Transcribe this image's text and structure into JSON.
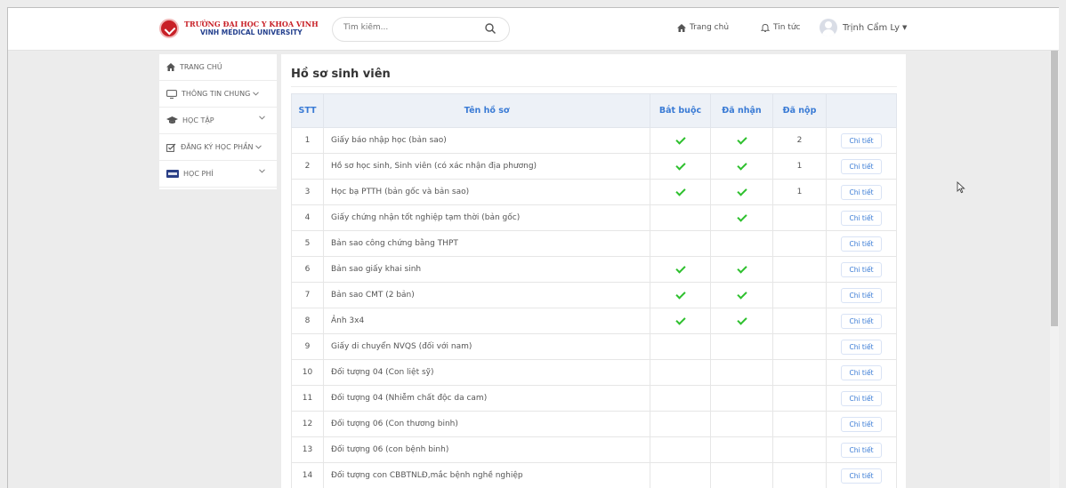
{
  "header": {
    "logo_line1": "TRƯỜNG ĐẠI HỌC Y KHOA VINH",
    "logo_line2": "VINH MEDICAL UNIVERSITY",
    "search_placeholder": "Tìm kiếm...",
    "nav_home": "Trang chủ",
    "nav_news": "Tin tức",
    "user_name": "Trịnh Cẩm Ly"
  },
  "sidebar": {
    "items": [
      {
        "label": "TRANG CHỦ",
        "icon": "home-icon"
      },
      {
        "label": "THÔNG TIN CHUNG",
        "icon": "monitor-icon"
      },
      {
        "label": "HỌC TẬP",
        "icon": "graduation-cap-icon"
      },
      {
        "label": "ĐĂNG KÝ HỌC PHẦN",
        "icon": "edit-icon"
      },
      {
        "label": "HỌC PHÍ",
        "icon": "visa-card-icon"
      }
    ]
  },
  "main": {
    "title": "Hồ sơ sinh viên",
    "columns": [
      "STT",
      "Tên hồ sơ",
      "Bắt buộc",
      "Đã nhận",
      "Đã nộp",
      ""
    ],
    "detail_label": "Chi tiết",
    "rows": [
      {
        "stt": "1",
        "name": "Giấy báo nhập học (bản sao)",
        "required": true,
        "received": true,
        "submitted": "2"
      },
      {
        "stt": "2",
        "name": "Hồ sơ học sinh, Sinh viên (có xác nhận địa phương)",
        "required": true,
        "received": true,
        "submitted": "1"
      },
      {
        "stt": "3",
        "name": "Học bạ PTTH (bản gốc và bản sao)",
        "required": true,
        "received": true,
        "submitted": "1"
      },
      {
        "stt": "4",
        "name": "Giấy chứng nhận tốt nghiệp tạm thời (bản gốc)",
        "required": false,
        "received": true,
        "submitted": ""
      },
      {
        "stt": "5",
        "name": "Bản sao công chứng bằng THPT",
        "required": false,
        "received": false,
        "submitted": ""
      },
      {
        "stt": "6",
        "name": "Bản sao giấy khai sinh",
        "required": true,
        "received": true,
        "submitted": ""
      },
      {
        "stt": "7",
        "name": "Bản sao CMT (2 bản)",
        "required": true,
        "received": true,
        "submitted": ""
      },
      {
        "stt": "8",
        "name": "Ảnh 3x4",
        "required": true,
        "received": true,
        "submitted": ""
      },
      {
        "stt": "9",
        "name": "Giấy di chuyển NVQS (đối với nam)",
        "required": false,
        "received": false,
        "submitted": ""
      },
      {
        "stt": "10",
        "name": "Đối tượng 04 (Con liệt sỹ)",
        "required": false,
        "received": false,
        "submitted": ""
      },
      {
        "stt": "11",
        "name": "Đối tượng 04 (Nhiễm chất độc da cam)",
        "required": false,
        "received": false,
        "submitted": ""
      },
      {
        "stt": "12",
        "name": "Đối tượng 06 (Con thương binh)",
        "required": false,
        "received": false,
        "submitted": ""
      },
      {
        "stt": "13",
        "name": "Đối tượng 06 (con bệnh binh)",
        "required": false,
        "received": false,
        "submitted": ""
      },
      {
        "stt": "14",
        "name": "Đối tượng con CBBTNLĐ,mắc bệnh nghề nghiệp",
        "required": false,
        "received": false,
        "submitted": ""
      }
    ]
  },
  "colors": {
    "accent": "#3a7bd5",
    "check": "#2ec02e",
    "brand_red": "#c82027",
    "brand_blue": "#24408e"
  }
}
